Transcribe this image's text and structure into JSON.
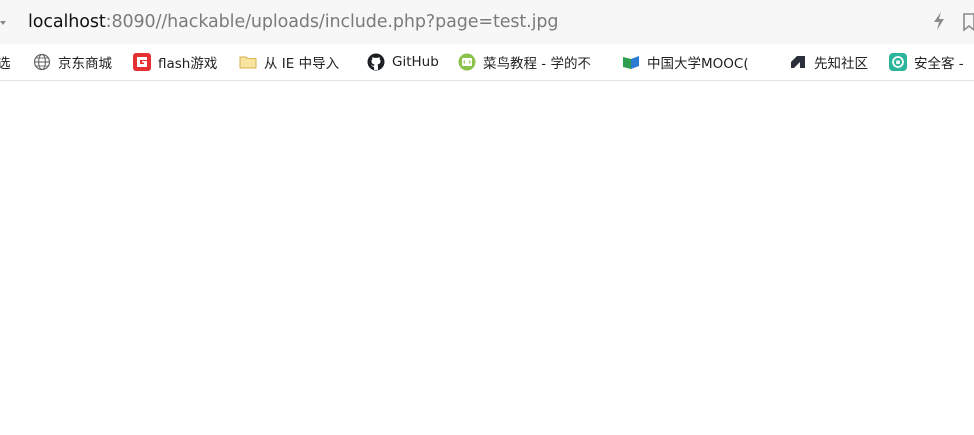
{
  "address_bar": {
    "url_host": "localhost",
    "url_rest": ":8090//hackable/uploads/include.php?page=test.jpg"
  },
  "bookmarks": [
    {
      "label": "选",
      "icon": "none"
    },
    {
      "label": "京东商城",
      "icon": "globe-icon"
    },
    {
      "label": "flash游戏",
      "icon": "flash-game-logo-icon"
    },
    {
      "label": "从 IE 中导入",
      "icon": "folder-icon"
    },
    {
      "label": "GitHub",
      "icon": "github-icon"
    },
    {
      "label": "菜鸟教程 - 学的不",
      "icon": "runoob-icon"
    },
    {
      "label": "中国大学MOOC(",
      "icon": "mooc-book-icon"
    },
    {
      "label": "先知社区",
      "icon": "xianzhi-icon"
    },
    {
      "label": "安全客 -",
      "icon": "anquanke-icon"
    }
  ],
  "colors": {
    "toolbar_bg": "#f7f7f7",
    "url_host": "#111111",
    "url_rest": "#7b7b7b",
    "flash_red": "#e5312f",
    "folder_yellow": "#f5d77a",
    "runoob_green": "#8bc34a",
    "mooc_green": "#2e9e4e",
    "mooc_blue": "#2a7bd1",
    "anquanke_teal": "#2bb59a"
  }
}
